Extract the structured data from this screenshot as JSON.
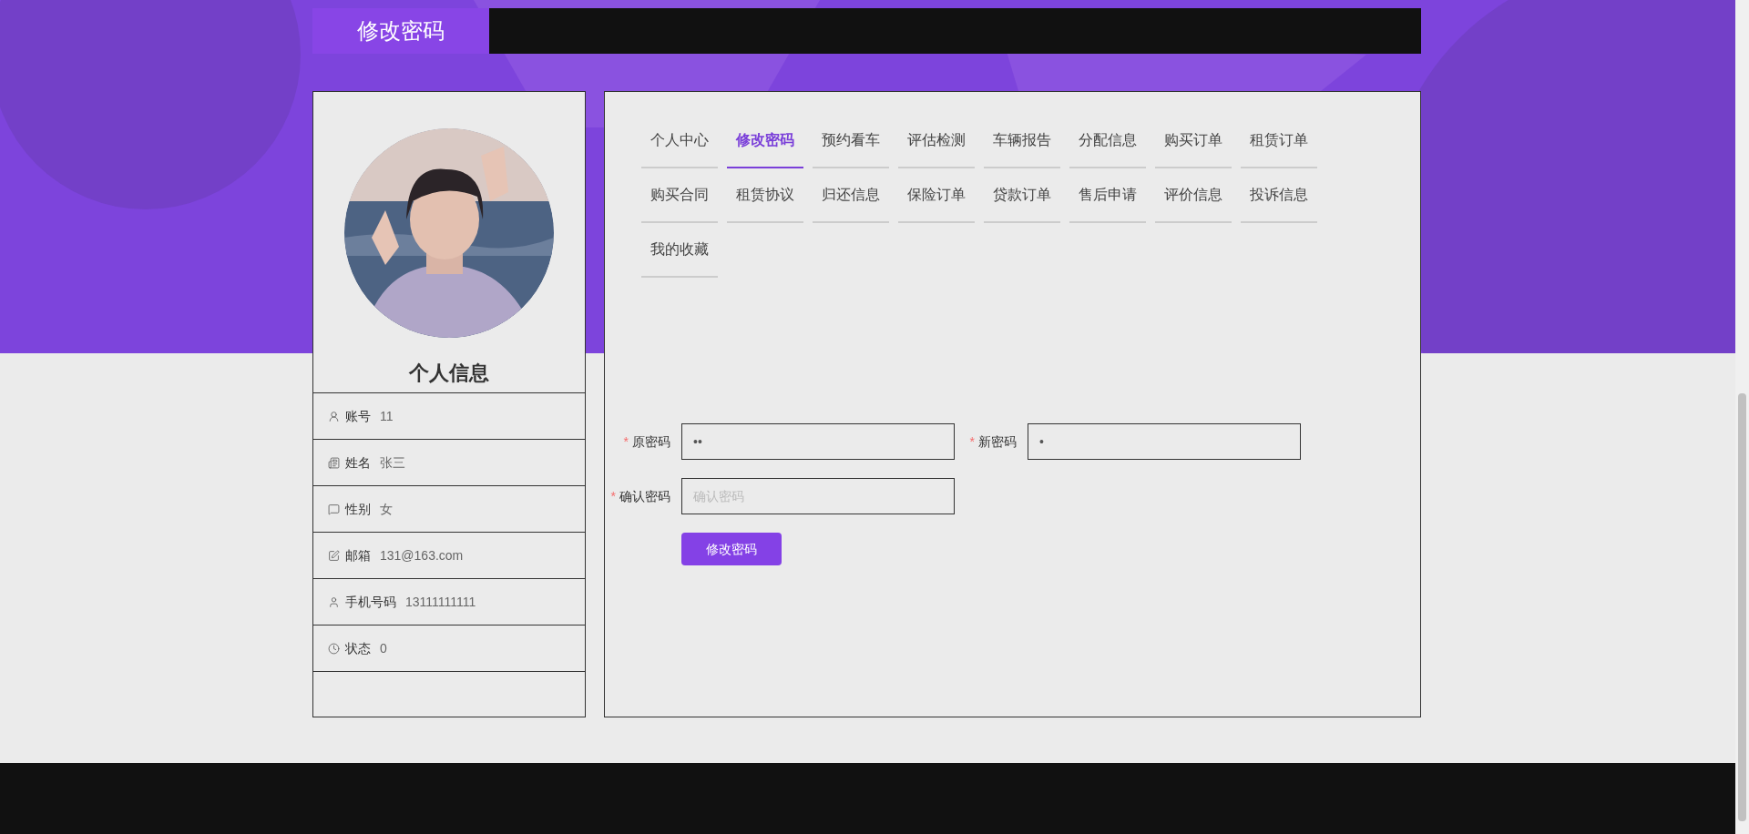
{
  "header": {
    "title": "修改密码"
  },
  "profile": {
    "title": "个人信息",
    "fields": [
      {
        "kind": "account",
        "label": "账号",
        "value": "11"
      },
      {
        "kind": "name",
        "label": "姓名",
        "value": "张三"
      },
      {
        "kind": "gender",
        "label": "性别",
        "value": "女"
      },
      {
        "kind": "email",
        "label": "邮箱",
        "value": "131@163.com"
      },
      {
        "kind": "phone",
        "label": "手机号码",
        "value": "13111111111"
      },
      {
        "kind": "status",
        "label": "状态",
        "value": "0"
      }
    ]
  },
  "tabs": [
    {
      "label": "个人中心",
      "selected": false
    },
    {
      "label": "修改密码",
      "selected": true
    },
    {
      "label": "预约看车",
      "selected": false
    },
    {
      "label": "评估检测",
      "selected": false
    },
    {
      "label": "车辆报告",
      "selected": false
    },
    {
      "label": "分配信息",
      "selected": false
    },
    {
      "label": "购买订单",
      "selected": false
    },
    {
      "label": "租赁订单",
      "selected": false
    },
    {
      "label": "购买合同",
      "selected": false
    },
    {
      "label": "租赁协议",
      "selected": false
    },
    {
      "label": "归还信息",
      "selected": false
    },
    {
      "label": "保险订单",
      "selected": false
    },
    {
      "label": "贷款订单",
      "selected": false
    },
    {
      "label": "售后申请",
      "selected": false
    },
    {
      "label": "评价信息",
      "selected": false
    },
    {
      "label": "投诉信息",
      "selected": false
    },
    {
      "label": "我的收藏",
      "selected": false
    }
  ],
  "form": {
    "fields": [
      {
        "label": "原密码",
        "required_mark": "*",
        "value": "••"
      },
      {
        "label": "新密码",
        "required_mark": "*",
        "value": "•"
      },
      {
        "label": "确认密码",
        "required_mark": "*",
        "placeholder": "确认密码"
      }
    ],
    "submit": "修改密码"
  }
}
